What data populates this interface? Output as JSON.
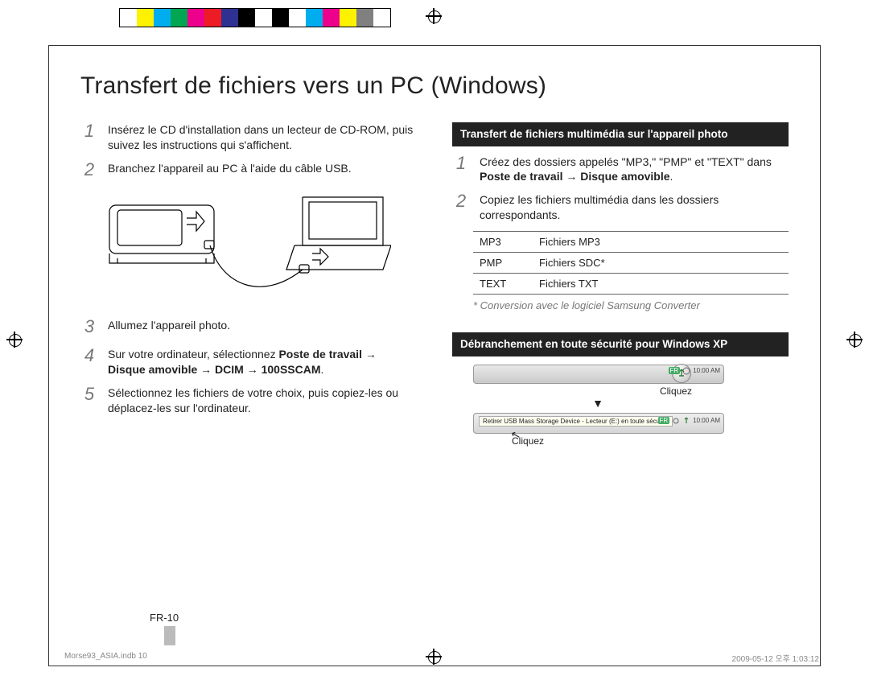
{
  "colorbar": [
    "#ffffff",
    "#fff200",
    "#00aeef",
    "#00a651",
    "#ec008c",
    "#ed1c24",
    "#2e3192",
    "#000000",
    "#ffffff",
    "#000000",
    "#ffffff",
    "#00aeef",
    "#ec008c",
    "#fff200",
    "#808080",
    "#ffffff"
  ],
  "title": "Transfert de fichiers vers un PC (Windows)",
  "left_steps": {
    "s1": "Insérez le CD d'installation dans un lecteur de CD-ROM, puis suivez les instructions qui s'affichent.",
    "s2": "Branchez l'appareil au PC à l'aide du câble USB.",
    "s3": "Allumez l'appareil photo.",
    "s4_a": "Sur votre ordinateur, sélectionnez ",
    "s4_b": "Poste de travail → Disque amovible → DCIM → 100SSCAM",
    "s4_c": ".",
    "s5": "Sélectionnez les fichiers de votre choix, puis copiez-les ou déplacez-les sur l'ordinateur."
  },
  "right": {
    "banner1": "Transfert de fichiers multimédia sur l'appareil photo",
    "r1_a": "Créez des dossiers appelés \"MP3,\" \"PMP\" et \"TEXT\" dans ",
    "r1_b": "Poste de travail → Disque amovible",
    "r1_c": ".",
    "r2": "Copiez les fichiers multimédia dans les dossiers correspondants.",
    "table": [
      {
        "k": "MP3",
        "v": "Fichiers MP3"
      },
      {
        "k": "PMP",
        "v": "Fichiers SDC*"
      },
      {
        "k": "TEXT",
        "v": "Fichiers TXT"
      }
    ],
    "footnote": "* Conversion avec le logiciel Samsung Converter",
    "banner2": "Débranchement en toute sécurité pour Windows XP",
    "clock": "10:00 AM",
    "tip": "Retirer USB Mass Storage Device - Lecteur (E:) en toute sécurité",
    "cap1": "Cliquez",
    "arrow": "▼",
    "cap2": "Cliquez"
  },
  "page_num": "FR-10",
  "footer_left": "Morse93_ASIA.indb   10",
  "footer_right": "2009-05-12   오후 1:03:12"
}
